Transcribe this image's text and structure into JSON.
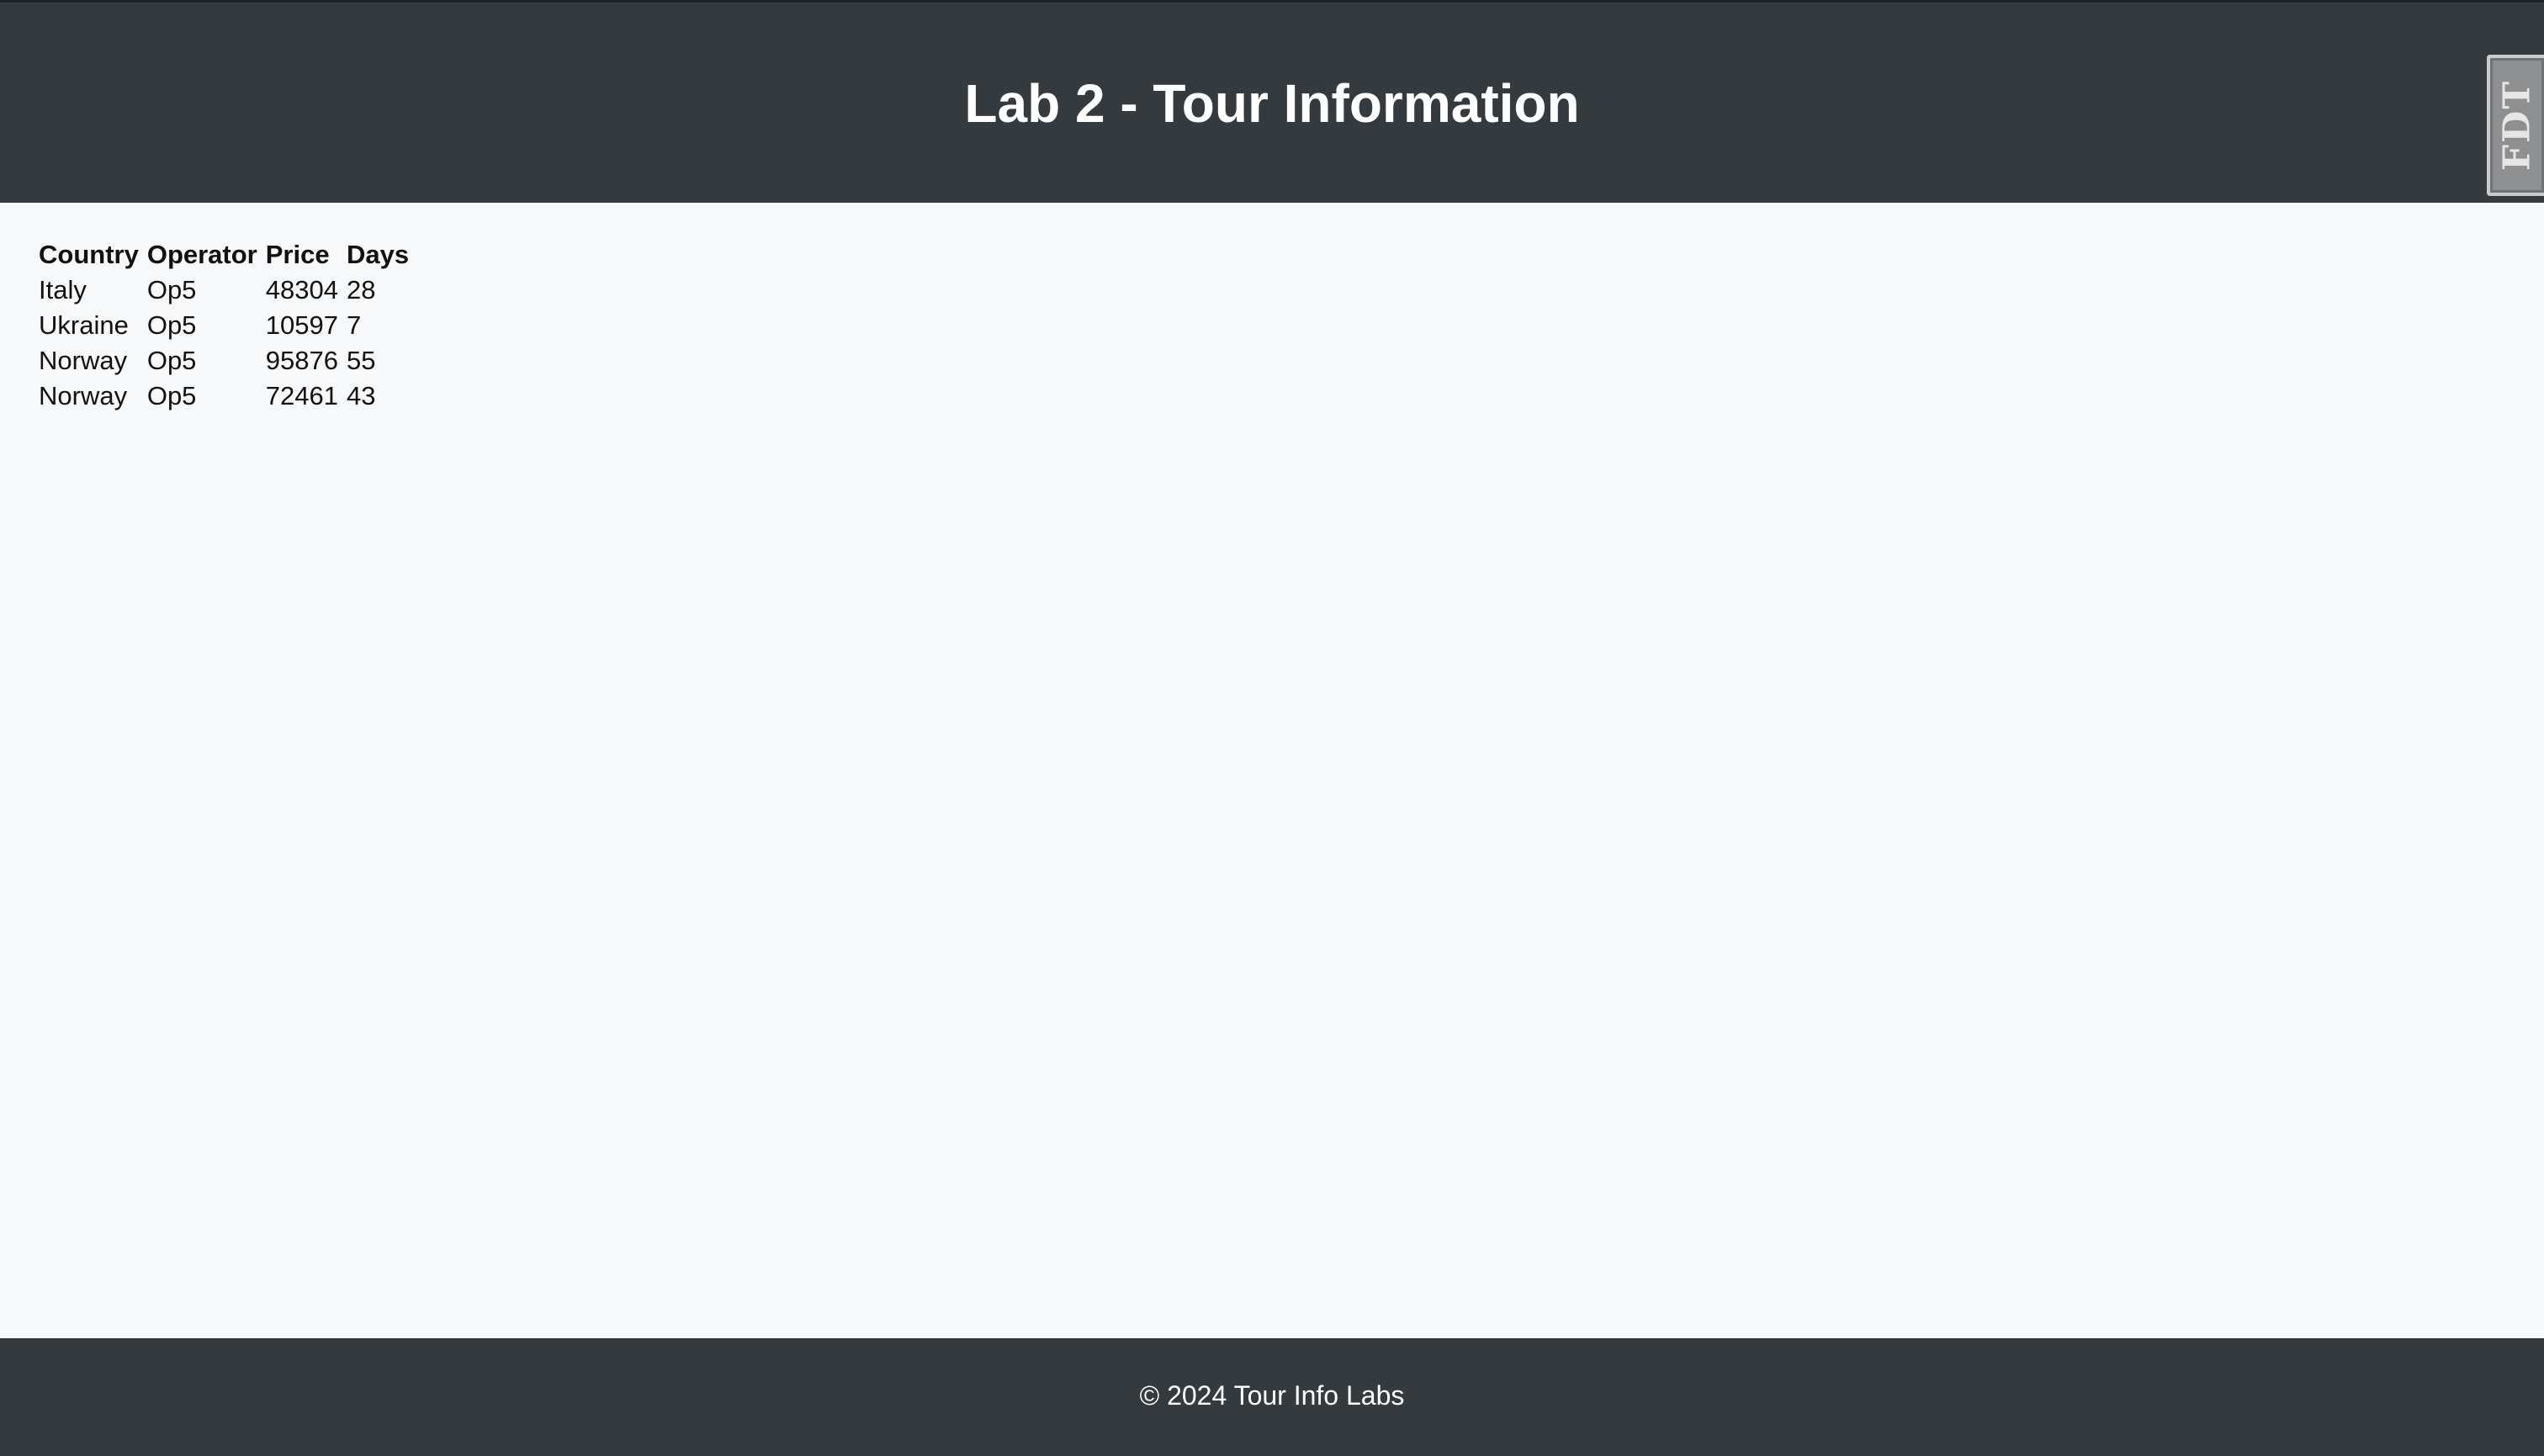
{
  "header": {
    "title": "Lab 2 - Tour Information",
    "extension_tab_label": "FDT",
    "background_color": "#353a3f"
  },
  "table": {
    "columns": [
      "Country",
      "Operator",
      "Price",
      "Days"
    ],
    "rows": [
      [
        "Italy",
        "Op5",
        "48304",
        "28"
      ],
      [
        "Ukraine",
        "Op5",
        "10597",
        "7"
      ],
      [
        "Norway",
        "Op5",
        "95876",
        "55"
      ],
      [
        "Norway",
        "Op5",
        "72461",
        "43"
      ]
    ]
  },
  "footer": {
    "text": "© 2024 Tour Info Labs",
    "background_color": "#353a3f"
  },
  "page": {
    "background_color": "#f6f8fa"
  }
}
